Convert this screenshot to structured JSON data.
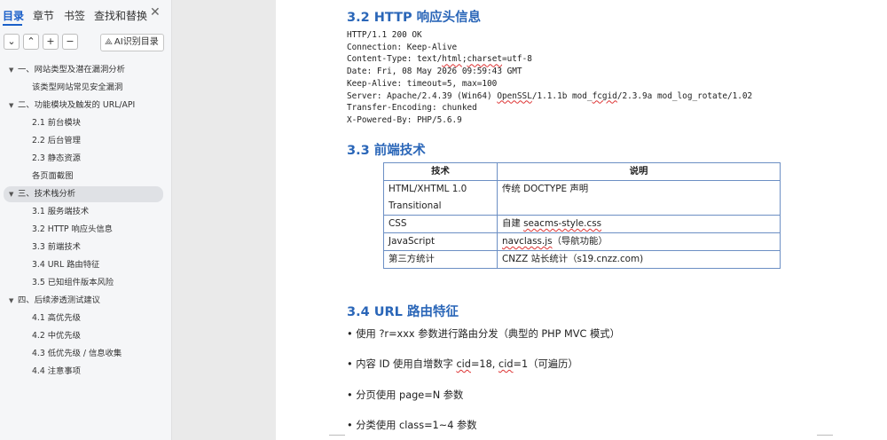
{
  "sidebar": {
    "tabs": [
      "目录",
      "章节",
      "书签",
      "查找和替换"
    ],
    "close": "✕",
    "toolbar": {
      "collapse": "⌄",
      "expand": "⌃",
      "add": "+",
      "remove": "−",
      "ai_label": "AI识别目录",
      "ai_icon": "ai-scan-icon"
    },
    "items": [
      {
        "label": "一、网站类型及潜在漏洞分析",
        "arrow": "▼"
      },
      {
        "label": "该类型网站常见安全漏洞",
        "arrow": ""
      },
      {
        "label": "二、功能模块及触发的 URL/API",
        "arrow": "▼"
      },
      {
        "label": "2.1 前台模块",
        "arrow": ""
      },
      {
        "label": "2.2 后台管理",
        "arrow": ""
      },
      {
        "label": "2.3 静态资源",
        "arrow": ""
      },
      {
        "label": "各页面截图",
        "arrow": ""
      },
      {
        "label": "三、技术栈分析",
        "arrow": "▼"
      },
      {
        "label": "3.1 服务端技术",
        "arrow": ""
      },
      {
        "label": "3.2 HTTP 响应头信息",
        "arrow": ""
      },
      {
        "label": "3.3 前端技术",
        "arrow": ""
      },
      {
        "label": "3.4 URL 路由特征",
        "arrow": ""
      },
      {
        "label": "3.5 已知组件版本风险",
        "arrow": ""
      },
      {
        "label": "四、后续渗透测试建议",
        "arrow": "▼"
      },
      {
        "label": "4.1 高优先级",
        "arrow": ""
      },
      {
        "label": "4.2 中优先级",
        "arrow": ""
      },
      {
        "label": "4.3 低优先级 / 信息收集",
        "arrow": ""
      },
      {
        "label": "4.4 注意事项",
        "arrow": ""
      }
    ]
  },
  "doc": {
    "h32": "3.2 HTTP 响应头信息",
    "headers": {
      "l1": "HTTP/1.1 200 OK",
      "l2": "Connection: Keep-Alive",
      "l3a": "Content-Type: text/",
      "l3b": "html",
      "l3c": ";",
      "l3d": "charset",
      "l3e": "=utf-8",
      "l4": "Date: Fri, 08 May 2026 09:59:43 GMT",
      "l5": "Keep-Alive: timeout=5, max=100",
      "l6a": "Server: Apache/2.4.39 (Win64) ",
      "l6b": "OpenSSL",
      "l6c": "/1.1.1b mod_",
      "l6d": "fcgid",
      "l6e": "/2.3.9a mod_log_rotate/1.02",
      "l7": "Transfer-Encoding: chunked",
      "l8": "X-Powered-By: PHP/5.6.9"
    },
    "h33": "3.3 前端技术",
    "table": {
      "col1": "技术",
      "col2": "说明",
      "r1c1": "HTML/XHTML 1.0 Transitional",
      "r1c2": "传统 DOCTYPE 声明",
      "r2c1": "CSS",
      "r2c2a": "自建 ",
      "r2c2b": "seacms-style.css",
      "r3c1": "JavaScript",
      "r3c2a": "navclass.js",
      "r3c2b": "（导航功能）",
      "r4c1": "第三方统计",
      "r4c2": "CNZZ 站长统计（s19.cnzz.com)"
    },
    "h34": "3.4 URL 路由特征",
    "b1": "• 使用 ?r=xxx 参数进行路由分发（典型的 PHP MVC 模式）",
    "b2a": "• 内容 ID 使用自增数字 ",
    "b2b": "cid",
    "b2c": "=18, ",
    "b2d": "cid",
    "b2e": "=1（可遍历）",
    "b3": "• 分页使用 page=N 参数",
    "b4": "• 分类使用 class=1~4 参数"
  }
}
